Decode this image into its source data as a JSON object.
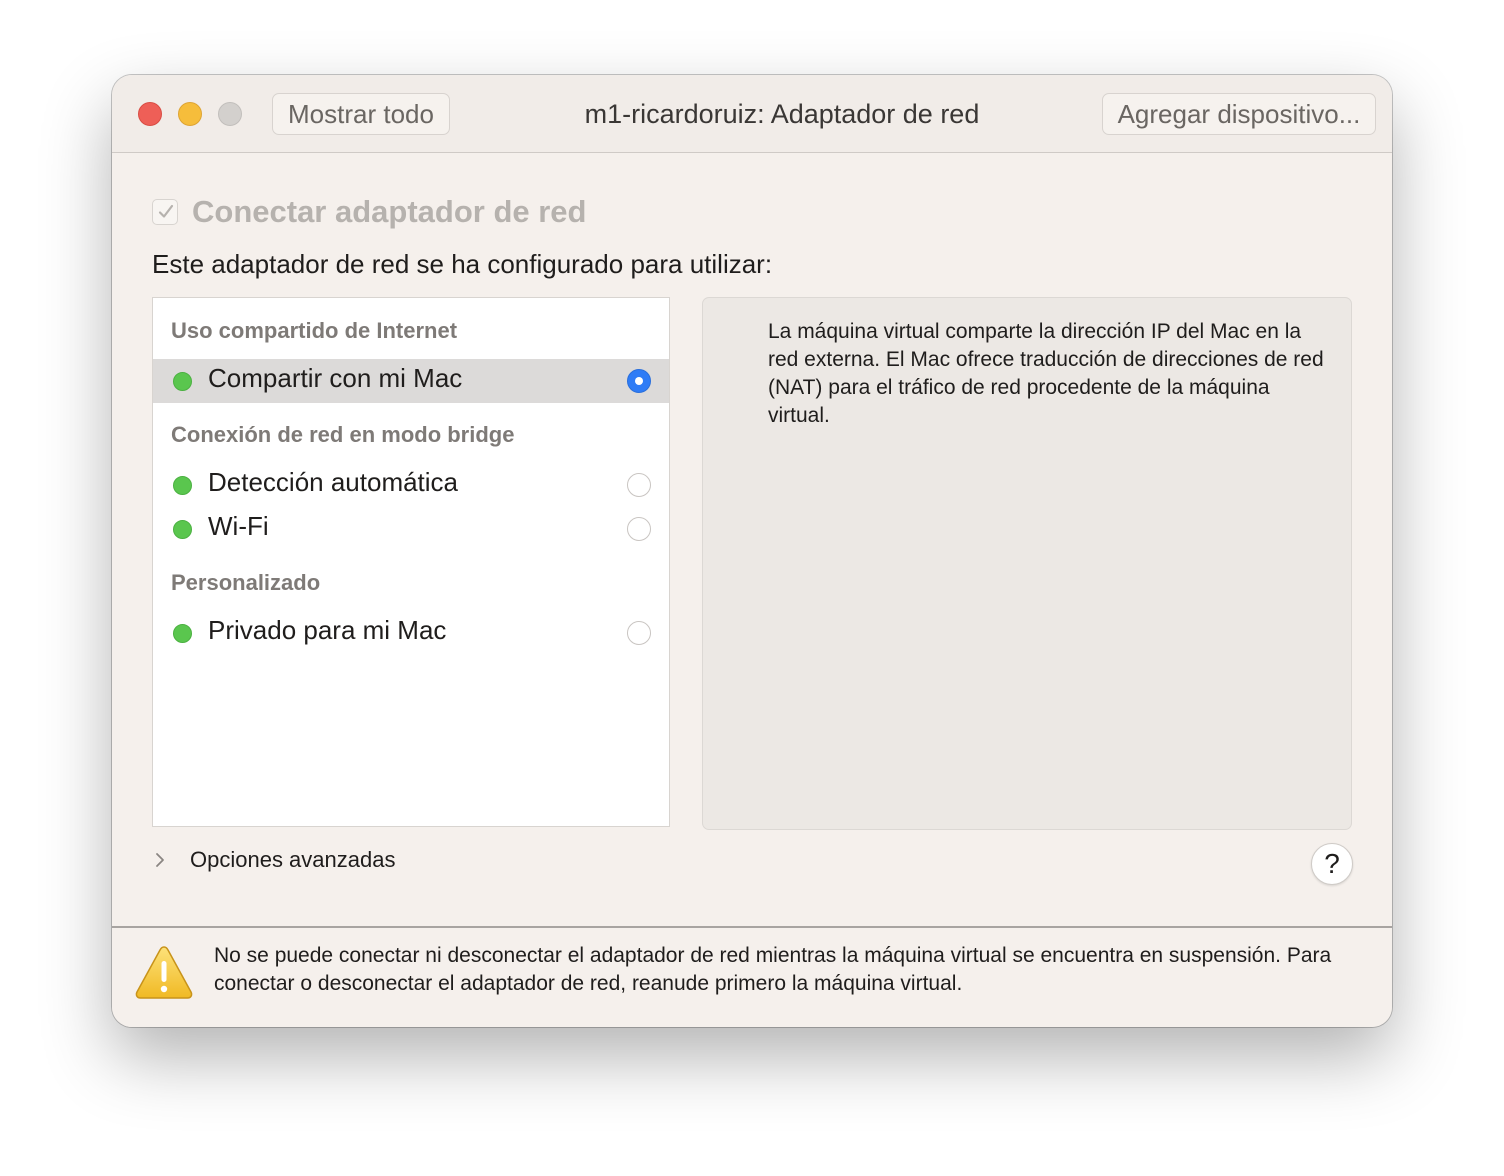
{
  "window": {
    "title": "m1-ricardoruiz: Adaptador de red",
    "show_all_label": "Mostrar todo",
    "add_device_label": "Agregar dispositivo..."
  },
  "connect": {
    "label": "Conectar adaptador de red",
    "checked": true,
    "enabled": false
  },
  "config_label": "Este adaptador de red se ha configurado para utilizar:",
  "sections": [
    {
      "header": "Uso compartido de Internet",
      "items": [
        {
          "label": "Compartir con mi Mac",
          "status": "green",
          "selected": true
        }
      ]
    },
    {
      "header": "Conexión de red en modo bridge",
      "items": [
        {
          "label": "Detección automática",
          "status": "green",
          "selected": false
        },
        {
          "label": "Wi-Fi",
          "status": "green",
          "selected": false
        }
      ]
    },
    {
      "header": "Personalizado",
      "items": [
        {
          "label": "Privado para mi Mac",
          "status": "green",
          "selected": false
        }
      ]
    }
  ],
  "description": "La máquina virtual comparte la dirección IP del Mac en la red externa. El Mac ofrece traducción de direcciones de red (NAT) para el tráfico de red procedente de la máquina virtual.",
  "advanced_label": "Opciones avanzadas",
  "help_label": "?",
  "warning": "No se puede conectar ni desconectar el adaptador de red mientras la máquina virtual se encuentra en suspensión. Para conectar o desconectar el adaptador de red, reanude primero la máquina virtual.",
  "colors": {
    "status_green": "#5ac64e",
    "accent_blue": "#2f7cf6",
    "selected_row": "#dcdad9"
  },
  "icons": {
    "close": "close-button",
    "minimize": "minimize-button",
    "zoom": "zoom-button",
    "checkbox": "checkmark-icon",
    "disclosure": "chevron-right-icon",
    "help": "question-mark-icon",
    "warning": "warning-triangle-icon"
  }
}
